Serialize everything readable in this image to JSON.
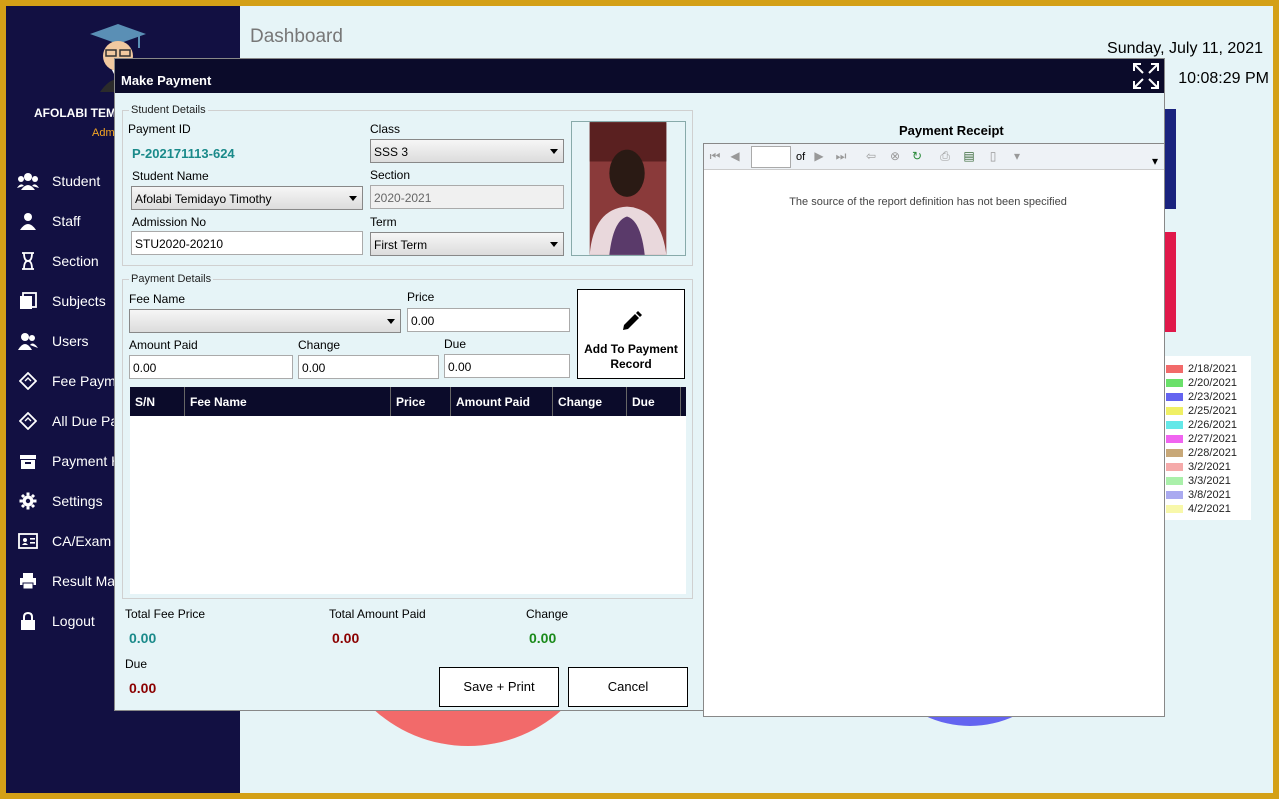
{
  "user": {
    "name": "AFOLABI TEM",
    "role": "Admi"
  },
  "sidebar": {
    "items": [
      {
        "label": "Student",
        "icon": "users-icon"
      },
      {
        "label": "Staff",
        "icon": "person-icon"
      },
      {
        "label": "Section",
        "icon": "hourglass-icon"
      },
      {
        "label": "Subjects",
        "icon": "books-icon"
      },
      {
        "label": "Users",
        "icon": "user-group-icon"
      },
      {
        "label": "Fee Paym",
        "icon": "ticket-icon"
      },
      {
        "label": "All Due Pa",
        "icon": "ticket-icon"
      },
      {
        "label": "Payment H",
        "icon": "basket-icon"
      },
      {
        "label": "Settings",
        "icon": "gear-icon"
      },
      {
        "label": "CA/Exam S",
        "icon": "id-card-icon"
      },
      {
        "label": "Result Mar",
        "icon": "printer-icon"
      },
      {
        "label": "Logout",
        "icon": "lock-icon"
      }
    ]
  },
  "dashboard": {
    "title": "Dashboard",
    "date": "Sunday, July 11, 2021",
    "time": "10:08:29 PM",
    "legend": [
      {
        "label": "2/18/2021",
        "color": "#f26a6a"
      },
      {
        "label": "2/20/2021",
        "color": "#6ae06a"
      },
      {
        "label": "2/23/2021",
        "color": "#6464f0"
      },
      {
        "label": "2/25/2021",
        "color": "#f0f064"
      },
      {
        "label": "2/26/2021",
        "color": "#64e8e8"
      },
      {
        "label": "2/27/2021",
        "color": "#f064f0"
      },
      {
        "label": "2/28/2021",
        "color": "#c8a878"
      },
      {
        "label": "3/2/2021",
        "color": "#f5aaaa"
      },
      {
        "label": "3/3/2021",
        "color": "#aaf0aa"
      },
      {
        "label": "3/8/2021",
        "color": "#aaaaf0"
      },
      {
        "label": "4/2/2021",
        "color": "#f8f8aa"
      }
    ]
  },
  "modal": {
    "title": "Make Payment",
    "student_details": {
      "legend": "Student Details",
      "payment_id_label": "Payment ID",
      "payment_id": "P-202171113-624",
      "class_label": "Class",
      "class_value": "SSS 3",
      "student_name_label": "Student Name",
      "student_name": "Afolabi Temidayo Timothy",
      "section_label": "Section",
      "section_value": "2020-2021",
      "admission_label": "Admission No",
      "admission_value": "STU2020-20210",
      "term_label": "Term",
      "term_value": "First Term"
    },
    "payment_details": {
      "legend": "Payment Details",
      "fee_name_label": "Fee Name",
      "fee_name_value": "",
      "price_label": "Price",
      "price_value": "0.00",
      "amount_paid_label": "Amount Paid",
      "amount_paid_value": "0.00",
      "change_label": "Change",
      "change_value": "0.00",
      "due_label": "Due",
      "due_value": "0.00",
      "add_button": "Add To Payment Record",
      "columns": [
        "S/N",
        "Fee Name",
        "Price",
        "Amount Paid",
        "Change",
        "Due"
      ]
    },
    "totals": {
      "total_fee_label": "Total Fee Price",
      "total_fee_value": "0.00",
      "total_paid_label": "Total Amount Paid",
      "total_paid_value": "0.00",
      "change_label": "Change",
      "change_value": "0.00",
      "due_label": "Due",
      "due_value": "0.00"
    },
    "buttons": {
      "save": "Save + Print",
      "cancel": "Cancel"
    },
    "receipt": {
      "title": "Payment Receipt",
      "of_label": "of",
      "message": "The source of the report definition has not been specified"
    }
  }
}
